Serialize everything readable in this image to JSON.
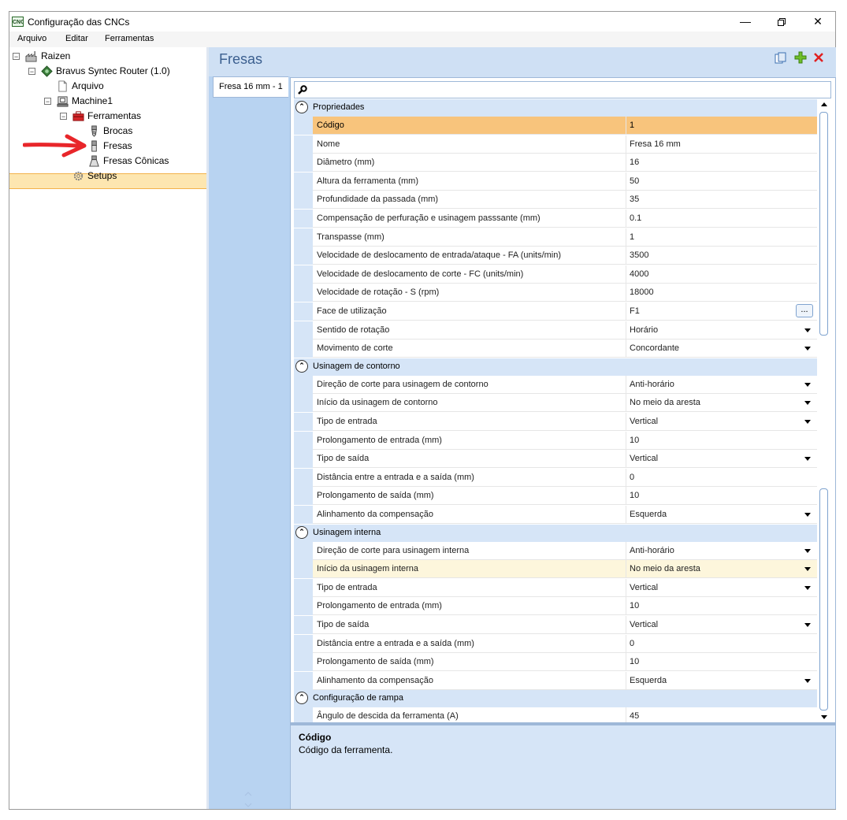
{
  "window": {
    "title": "Configuração das CNCs",
    "icon_text": "CNC",
    "controls": [
      "minimize-icon",
      "restore-icon",
      "close-icon"
    ]
  },
  "menu": [
    "Arquivo",
    "Editar",
    "Ferramentas"
  ],
  "tree": {
    "root": "Raizen",
    "router": "Bravus Syntec Router (1.0)",
    "arquivo": "Arquivo",
    "machine": "Machine1",
    "ferramentas": "Ferramentas",
    "brocas": "Brocas",
    "fresas": "Fresas",
    "fresas_conicas": "Fresas Cônicas",
    "setups": "Setups"
  },
  "panel": {
    "title": "Fresas",
    "tab": "Fresa 16 mm - 1",
    "toolbar_icons": [
      "copy-icon",
      "add-icon",
      "delete-icon"
    ]
  },
  "grid": {
    "categories": [
      {
        "label": "Propriedades",
        "rows": [
          {
            "name": "Código",
            "value": "1",
            "control": "none"
          },
          {
            "name": "Nome",
            "value": "Fresa 16 mm",
            "control": "none"
          },
          {
            "name": "Diâmetro (mm)",
            "value": "16",
            "control": "none"
          },
          {
            "name": "Altura da ferramenta (mm)",
            "value": "50",
            "control": "none"
          },
          {
            "name": "Profundidade da passada (mm)",
            "value": "35",
            "control": "none"
          },
          {
            "name": "Compensação de perfuração e usinagem passsante (mm)",
            "value": "0.1",
            "control": "none"
          },
          {
            "name": "Transpasse (mm)",
            "value": "1",
            "control": "none"
          },
          {
            "name": "Velocidade de deslocamento de entrada/ataque - FA (units/min)",
            "value": "3500",
            "control": "none"
          },
          {
            "name": "Velocidade de deslocamento de corte - FC (units/min)",
            "value": "4000",
            "control": "none"
          },
          {
            "name": "Velocidade de rotação - S (rpm)",
            "value": "18000",
            "control": "none"
          },
          {
            "name": "Face de utilização",
            "value": "F1",
            "control": "ellipsis",
            "ellipsis": "..."
          },
          {
            "name": "Sentido de rotação",
            "value": "Horário",
            "control": "dropdown"
          },
          {
            "name": "Movimento de corte",
            "value": "Concordante",
            "control": "dropdown"
          }
        ]
      },
      {
        "label": "Usinagem de contorno",
        "rows": [
          {
            "name": "Direção de corte para usinagem de contorno",
            "value": "Anti-horário",
            "control": "dropdown"
          },
          {
            "name": "Início da usinagem de contorno",
            "value": "No meio da aresta",
            "control": "dropdown"
          },
          {
            "name": "Tipo de entrada",
            "value": "Vertical",
            "control": "dropdown"
          },
          {
            "name": "Prolongamento de entrada (mm)",
            "value": "10",
            "control": "none"
          },
          {
            "name": "Tipo de saída",
            "value": "Vertical",
            "control": "dropdown"
          },
          {
            "name": "Distância entre a entrada e a saída (mm)",
            "value": "0",
            "control": "none"
          },
          {
            "name": "Prolongamento de saída (mm)",
            "value": "10",
            "control": "none"
          },
          {
            "name": "Alinhamento da compensação",
            "value": "Esquerda",
            "control": "dropdown"
          }
        ]
      },
      {
        "label": "Usinagem interna",
        "rows": [
          {
            "name": "Direção de corte para usinagem interna",
            "value": "Anti-horário",
            "control": "dropdown"
          },
          {
            "name": "Início da usinagem interna",
            "value": "No meio da aresta",
            "control": "dropdown"
          },
          {
            "name": "Tipo de entrada",
            "value": "Vertical",
            "control": "dropdown"
          },
          {
            "name": "Prolongamento de entrada (mm)",
            "value": "10",
            "control": "none"
          },
          {
            "name": "Tipo de saída",
            "value": "Vertical",
            "control": "dropdown"
          },
          {
            "name": "Distância entre a entrada e a saída (mm)",
            "value": "0",
            "control": "none"
          },
          {
            "name": "Prolongamento de saída (mm)",
            "value": "10",
            "control": "none"
          },
          {
            "name": "Alinhamento da compensação",
            "value": "Esquerda",
            "control": "dropdown"
          }
        ]
      },
      {
        "label": "Configuração de rampa",
        "rows": [
          {
            "name": "Ângulo de descida da ferramenta (A)",
            "value": "45",
            "control": "none"
          }
        ]
      }
    ]
  },
  "description": {
    "title": "Código",
    "text": "Código da ferramenta."
  },
  "colors": {
    "selection": "#f8c47c",
    "category": "#d6e5f7",
    "accent_title": "#3b5f8f",
    "tree_selection": "#fde6b0",
    "arrow": "#e8262a"
  }
}
